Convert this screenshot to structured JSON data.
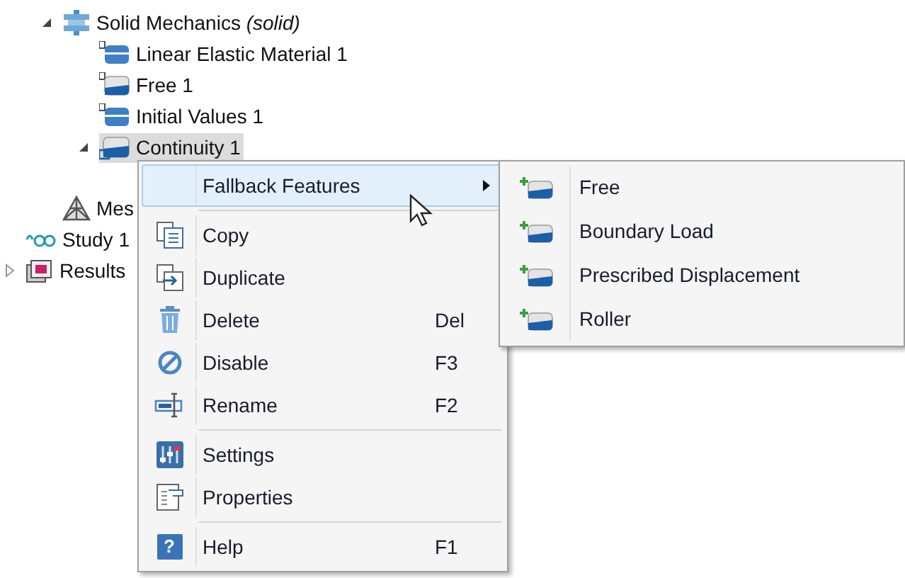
{
  "tree": {
    "partial_branch": [
      {
        "kind": "physics",
        "label": "Solid Mechanics *(solid)*",
        "expanded": true,
        "selected": false,
        "children": [
          {
            "kind": "feature",
            "label": "Linear Elastic Material 1",
            "selected": false
          },
          {
            "kind": "feature_boundary",
            "label": "Free 1",
            "selected": false
          },
          {
            "kind": "feature",
            "label": "Initial Values 1",
            "selected": false
          },
          {
            "kind": "pair",
            "label": "Continuity 1",
            "expanded": true,
            "selected": true
          }
        ]
      },
      {
        "kind": "mesh",
        "label": "Mes",
        "selected": false
      }
    ],
    "items": [
      {
        "kind": "study",
        "label": "Study 1",
        "selected": false
      },
      {
        "kind": "results",
        "label": "Results",
        "expanded": false,
        "selected": false
      }
    ]
  },
  "context_menu": {
    "items": [
      {
        "kind": "submenu",
        "label": "Fallback Features",
        "selected": true
      },
      {
        "kind": "separator"
      },
      {
        "kind": "item",
        "label": "Copy",
        "selected": false
      },
      {
        "kind": "item",
        "label": "Duplicate",
        "selected": false
      },
      {
        "kind": "item",
        "label": "Delete",
        "shortcut": "Del",
        "selected": false
      },
      {
        "kind": "item",
        "label": "Disable",
        "shortcut": "F3",
        "selected": false
      },
      {
        "kind": "item",
        "label": "Rename",
        "shortcut": "F2",
        "selected": false
      },
      {
        "kind": "separator"
      },
      {
        "kind": "item",
        "label": "Settings",
        "selected": false
      },
      {
        "kind": "item",
        "label": "Properties",
        "selected": false
      },
      {
        "kind": "separator"
      },
      {
        "kind": "item",
        "label": "Help",
        "shortcut": "F1",
        "icon_glyph": "?",
        "selected": false
      }
    ]
  },
  "submenu": {
    "items": [
      {
        "label": "Free"
      },
      {
        "label": "Boundary Load"
      },
      {
        "label": "Prescribed Displacement"
      },
      {
        "label": "Roller"
      }
    ]
  }
}
